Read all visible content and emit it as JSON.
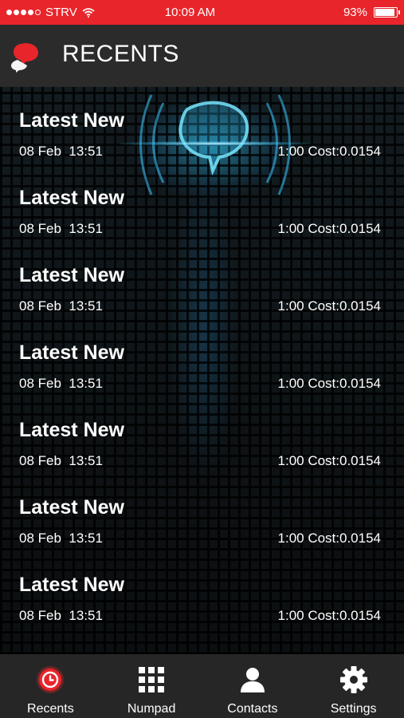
{
  "status_bar": {
    "carrier": "STRV",
    "time": "10:09 AM",
    "battery": "93%",
    "battery_level": 0.93,
    "signal_bars": 4
  },
  "header": {
    "title": "RECENTS",
    "logo_icon": "chat-bubbles-icon"
  },
  "recents": [
    {
      "name": "Latest New",
      "date": "08 Feb",
      "time": "13:51",
      "duration_cost": "1:00 Cost:0.0154"
    },
    {
      "name": "Latest New",
      "date": "08 Feb",
      "time": "13:51",
      "duration_cost": "1:00 Cost:0.0154"
    },
    {
      "name": "Latest New",
      "date": "08 Feb",
      "time": "13:51",
      "duration_cost": "1:00 Cost:0.0154"
    },
    {
      "name": "Latest New",
      "date": "08 Feb",
      "time": "13:51",
      "duration_cost": "1:00 Cost:0.0154"
    },
    {
      "name": "Latest New",
      "date": "08 Feb",
      "time": "13:51",
      "duration_cost": "1:00 Cost:0.0154"
    },
    {
      "name": "Latest New",
      "date": "08 Feb",
      "time": "13:51",
      "duration_cost": "1:00 Cost:0.0154"
    },
    {
      "name": "Latest New",
      "date": "08 Feb",
      "time": "13:51",
      "duration_cost": "1:00 Cost:0.0154"
    }
  ],
  "tabs": [
    {
      "label": "Recents",
      "icon": "clock-icon",
      "active": true
    },
    {
      "label": "Numpad",
      "icon": "keypad-grid-icon",
      "active": false
    },
    {
      "label": "Contacts",
      "icon": "person-icon",
      "active": false
    },
    {
      "label": "Settings",
      "icon": "gear-icon",
      "active": false
    }
  ],
  "colors": {
    "status_bar": "#e8252a",
    "header": "#2b2b2c",
    "tab_bar": "#262626",
    "accent": "#e8252a"
  }
}
